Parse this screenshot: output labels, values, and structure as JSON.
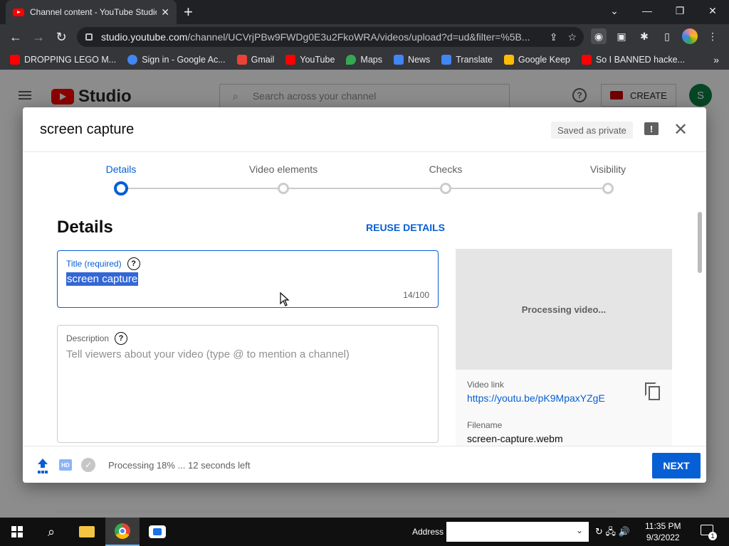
{
  "browser": {
    "tab_title": "Channel content - YouTube Studio",
    "tab_close": "✕",
    "new_tab": "+",
    "window_controls": {
      "minimize": "—",
      "restore": "❐",
      "close": "✕",
      "tab_search": "⌄"
    },
    "url_host": "studio.youtube.com",
    "url_path": "/channel/UCVrjPBw9FWDg0E3u2FkoWRA/videos/upload?d=ud&filter=%5B...",
    "bookmarks": [
      {
        "label": "DROPPING LEGO M...",
        "color": "#ff0000"
      },
      {
        "label": "Sign in - Google Ac...",
        "color": "#4285f4"
      },
      {
        "label": "Gmail",
        "color": "#ea4335"
      },
      {
        "label": "YouTube",
        "color": "#ff0000"
      },
      {
        "label": "Maps",
        "color": "#34a853"
      },
      {
        "label": "News",
        "color": "#4285f4"
      },
      {
        "label": "Translate",
        "color": "#4285f4"
      },
      {
        "label": "Google Keep",
        "color": "#fbbc04"
      },
      {
        "label": "So I BANNED hacke...",
        "color": "#ff0000"
      }
    ],
    "bookmarks_more": "»"
  },
  "studio": {
    "logo_text": "Studio",
    "search_placeholder": "Search across your channel",
    "create_label": "CREATE",
    "avatar_letter": "S",
    "help_glyph": "?"
  },
  "dialog": {
    "title": "screen capture",
    "saved_status": "Saved as private",
    "feedback_glyph": "!",
    "close_glyph": "✕",
    "steps": [
      {
        "label": "Details",
        "active": true
      },
      {
        "label": "Video elements",
        "active": false
      },
      {
        "label": "Checks",
        "active": false
      },
      {
        "label": "Visibility",
        "active": false
      }
    ],
    "section_heading": "Details",
    "reuse_label": "REUSE DETAILS",
    "title_field": {
      "label": "Title (required)",
      "value": "screen capture",
      "counter": "14/100",
      "help_glyph": "?"
    },
    "description_field": {
      "label": "Description",
      "placeholder": "Tell viewers about your video (type @ to mention a channel)",
      "help_glyph": "?"
    },
    "preview": {
      "processing_text": "Processing video...",
      "video_link_label": "Video link",
      "video_link": "https://youtu.be/pK9MpaxYZgE",
      "filename_label": "Filename",
      "filename": "screen-capture.webm"
    },
    "footer": {
      "hd_badge": "HD",
      "check_glyph": "✓",
      "status_text": "Processing 18% ... 12 seconds left",
      "next_label": "NEXT"
    }
  },
  "taskbar": {
    "address_label": "Address",
    "address_dropdown": "⌄",
    "time": "11:35 PM",
    "date": "9/3/2022",
    "sys_icons": "↻ 🖧 🔊",
    "notification_count": "1"
  },
  "colors": {
    "accent": "#065fd4",
    "youtube_red": "#ff0000",
    "selection": "#3367d6"
  }
}
